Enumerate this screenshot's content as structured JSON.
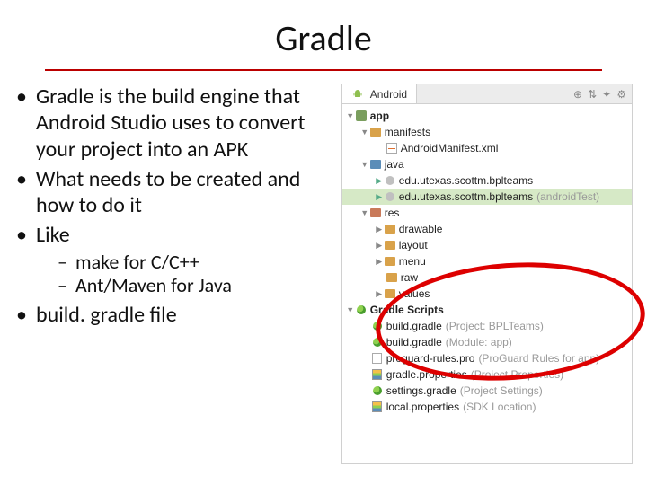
{
  "title": "Gradle",
  "bullets": {
    "b1": "Gradle is the build engine that Android Studio uses to convert your project into an APK",
    "b2": "What needs to be created and how to do it",
    "b3": "Like",
    "b3a": "make for C/C++",
    "b3b": "Ant/Maven for Java",
    "b4": "build. gradle file"
  },
  "ide": {
    "tab": "Android",
    "toolbar": {
      "i1": "⊕",
      "i2": "⇅",
      "i3": "✦",
      "i4": "⚙"
    },
    "tree": {
      "app": "app",
      "manifests": "manifests",
      "manifest_file": "AndroidManifest.xml",
      "java": "java",
      "pkg1": "edu.utexas.scottm.bplteams",
      "pkg2": "edu.utexas.scottm.bplteams",
      "pkg2_suffix": "(androidTest)",
      "res": "res",
      "drawable": "drawable",
      "layout": "layout",
      "menu": "menu",
      "raw": "raw",
      "values": "values",
      "gradle_scripts": "Gradle Scripts",
      "bg1": "build.gradle",
      "bg1_suffix": "(Project: BPLTeams)",
      "bg2": "build.gradle",
      "bg2_suffix": "(Module: app)",
      "pr": "proguard-rules.pro",
      "pr_suffix": "(ProGuard Rules for app)",
      "gp": "gradle.properties",
      "gp_suffix": "(Project Properties)",
      "sg": "settings.gradle",
      "sg_suffix": "(Project Settings)",
      "lp": "local.properties",
      "lp_suffix": "(SDK Location)"
    }
  }
}
